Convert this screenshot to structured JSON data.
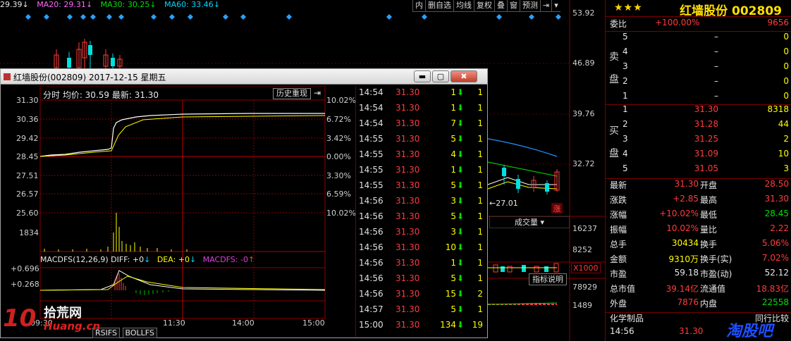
{
  "ma_bar": {
    "ma10": "29.39",
    "ma20": "MA20: 29.31",
    "ma30": "MA30: 30.25",
    "ma60": "MA60: 33.46"
  },
  "toolbar": [
    "内",
    "删自选",
    "均线",
    "复权",
    "叠",
    "窗",
    "预测"
  ],
  "price_axis": [
    "53.92",
    "46.89",
    "39.76",
    "32.72"
  ],
  "volume_axis": [
    "16237",
    "8252"
  ],
  "macd_axis": [
    "78929",
    "1489"
  ],
  "chart_labels": {
    "low_mark": "27.01",
    "zhang": "涨",
    "volume_dropdown": "成交量",
    "x1000": "X1000",
    "indicator_help": "指标说明"
  },
  "window": {
    "title": "红墙股份(002809) 2017-12-15 星期五",
    "btn_min": "▬",
    "btn_max": "▢",
    "btn_close": "✖"
  },
  "intraday": {
    "header": "分时 均价: 30.59 最新: 31.30",
    "history_btn": "历史重现",
    "left_axis": [
      "31.30",
      "30.36",
      "29.42",
      "28.45",
      "27.51",
      "26.57",
      "25.60",
      "1834"
    ],
    "right_axis": [
      "10.02%",
      "6.72%",
      "3.42%",
      "0.00%",
      "3.30%",
      "6.59%",
      "10.02%"
    ],
    "macd_header": "MACDFS(12,26,9) DIFF: +0",
    "dea": "DEA: +0",
    "macdfs": "MACDFS: -0",
    "macd_axis": [
      "+0.696",
      "+0.268"
    ],
    "time_axis": [
      "09:30",
      "11:30",
      "14:00",
      "15:00"
    ],
    "tabs": [
      "RSIFS",
      "BOLLFS"
    ]
  },
  "ticks": [
    {
      "time": "14:54",
      "price": "31.30",
      "vol": "1",
      "cnt": "1"
    },
    {
      "time": "14:54",
      "price": "31.30",
      "vol": "1",
      "cnt": "1"
    },
    {
      "time": "14:54",
      "price": "31.30",
      "vol": "7",
      "cnt": "1"
    },
    {
      "time": "14:55",
      "price": "31.30",
      "vol": "5",
      "cnt": "1"
    },
    {
      "time": "14:55",
      "price": "31.30",
      "vol": "4",
      "cnt": "1"
    },
    {
      "time": "14:55",
      "price": "31.30",
      "vol": "1",
      "cnt": "1"
    },
    {
      "time": "14:55",
      "price": "31.30",
      "vol": "5",
      "cnt": "1"
    },
    {
      "time": "14:56",
      "price": "31.30",
      "vol": "3",
      "cnt": "1"
    },
    {
      "time": "14:56",
      "price": "31.30",
      "vol": "5",
      "cnt": "1"
    },
    {
      "time": "14:56",
      "price": "31.30",
      "vol": "3",
      "cnt": "1"
    },
    {
      "time": "14:56",
      "price": "31.30",
      "vol": "10",
      "cnt": "1"
    },
    {
      "time": "14:56",
      "price": "31.30",
      "vol": "1",
      "cnt": "1"
    },
    {
      "time": "14:56",
      "price": "31.30",
      "vol": "5",
      "cnt": "1"
    },
    {
      "time": "14:56",
      "price": "31.30",
      "vol": "15",
      "cnt": "2"
    },
    {
      "time": "14:57",
      "price": "31.30",
      "vol": "5",
      "cnt": "1"
    },
    {
      "time": "15:00",
      "price": "31.30",
      "vol": "134",
      "cnt": "19"
    }
  ],
  "quote": {
    "stars": "★★★",
    "title": "红墙股份 002809",
    "weibi_label": "委比",
    "weibi_pct": "+100.00%",
    "weibi_val": "9656",
    "sell_label": [
      "卖",
      "盘"
    ],
    "buy_label": [
      "买",
      "盘"
    ],
    "sell": [
      {
        "lvl": "5",
        "price": "–",
        "vol": "0"
      },
      {
        "lvl": "4",
        "price": "–",
        "vol": "0"
      },
      {
        "lvl": "3",
        "price": "–",
        "vol": "0"
      },
      {
        "lvl": "2",
        "price": "–",
        "vol": "0"
      },
      {
        "lvl": "1",
        "price": "–",
        "vol": "0"
      }
    ],
    "buy": [
      {
        "lvl": "1",
        "price": "31.30",
        "vol": "8318"
      },
      {
        "lvl": "2",
        "price": "31.28",
        "vol": "44"
      },
      {
        "lvl": "3",
        "price": "31.25",
        "vol": "2"
      },
      {
        "lvl": "4",
        "price": "31.09",
        "vol": "10"
      },
      {
        "lvl": "5",
        "price": "31.05",
        "vol": "3"
      }
    ],
    "stats": [
      {
        "l1": "最新",
        "v1": "31.30",
        "l2": "开盘",
        "v2": "28.50"
      },
      {
        "l1": "涨跌",
        "v1": "+2.85",
        "l2": "最高",
        "v2": "31.30"
      },
      {
        "l1": "涨幅",
        "v1": "+10.02%",
        "l2": "最低",
        "v2": "28.45"
      },
      {
        "l1": "振幅",
        "v1": "10.02%",
        "l2": "量比",
        "v2": "2.22"
      },
      {
        "l1": "总手",
        "v1": "30434",
        "l2": "换手",
        "v2": "5.06%"
      },
      {
        "l1": "金额",
        "v1": "9310万",
        "l2": "换手(实)",
        "v2": "7.02%"
      },
      {
        "l1": "市盈",
        "v1": "59.18",
        "l2": "市盈(动)",
        "v2": "52.12"
      },
      {
        "l1": "总市值",
        "v1": "39.14亿",
        "l2": "流通值",
        "v2": "18.83亿"
      },
      {
        "l1": "外盘",
        "v1": "7876",
        "l2": "内盘",
        "v2": "22558"
      }
    ],
    "sector": "化学制品",
    "sector_right": "同行比较",
    "last_time": "14:56",
    "last_price": "31.30"
  },
  "watermark": {
    "logo_cn": "拾荒网",
    "logo_en": "Huang.cn",
    "logo_num": "10",
    "logo2": "淘股吧"
  }
}
